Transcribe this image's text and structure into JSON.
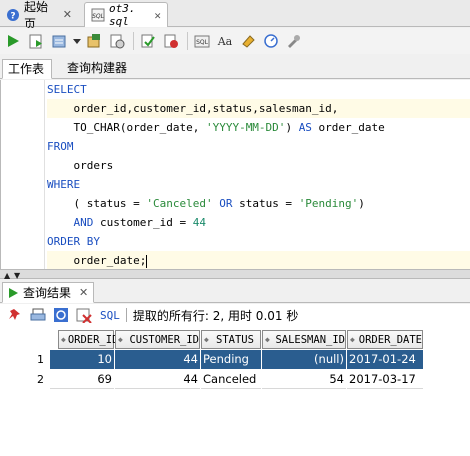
{
  "doc_tabs": [
    {
      "label": "起始页",
      "icon": "help-circle-icon"
    },
    {
      "label": "ot3. sql",
      "icon": "sql-file-icon"
    }
  ],
  "worksheet_tabs": [
    "工作表",
    "查询构建器"
  ],
  "code_lines": [
    [
      [
        "kw",
        "SELECT"
      ]
    ],
    [
      [
        "t",
        "    order_id,customer_id,status,salesman_id,"
      ]
    ],
    [
      [
        "t",
        "    TO_CHAR(order_date, "
      ],
      [
        "str",
        "'YYYY-MM-DD'"
      ],
      [
        "t",
        ") "
      ],
      [
        "kw",
        "AS"
      ],
      [
        "t",
        " order_date"
      ]
    ],
    [
      [
        "kw",
        "FROM"
      ]
    ],
    [
      [
        "t",
        "    orders"
      ]
    ],
    [
      [
        "kw",
        "WHERE"
      ]
    ],
    [
      [
        "t",
        "    ( status = "
      ],
      [
        "str",
        "'Canceled'"
      ],
      [
        "t",
        " "
      ],
      [
        "kw",
        "OR"
      ],
      [
        "t",
        " status = "
      ],
      [
        "str",
        "'Pending'"
      ],
      [
        "t",
        ")"
      ]
    ],
    [
      [
        "t",
        "    "
      ],
      [
        "kw",
        "AND"
      ],
      [
        "t",
        " customer_id = "
      ],
      [
        "num",
        "44"
      ]
    ],
    [
      [
        "kw",
        "ORDER BY"
      ]
    ],
    [
      [
        "t",
        "    order_date;"
      ]
    ]
  ],
  "results_tab": {
    "label": "查询结果"
  },
  "results_toolbar": {
    "sql_label": "SQL",
    "status": "提取的所有行: 2, 用时 0.01 秒"
  },
  "grid": {
    "columns": [
      "ORDER_ID",
      "CUSTOMER_ID",
      "STATUS",
      "SALESMAN_ID",
      "ORDER_DATE"
    ],
    "rows": [
      {
        "num": "1",
        "cells": [
          "10",
          "44",
          "Pending",
          "(null)",
          "2017-01-24"
        ]
      },
      {
        "num": "2",
        "cells": [
          "69",
          "44",
          "Canceled",
          "54",
          "2017-03-17"
        ]
      }
    ]
  },
  "colors": {
    "selected_row": "#2a5d8f",
    "keyword": "#1a4ec0",
    "string": "#2a8a3a"
  }
}
